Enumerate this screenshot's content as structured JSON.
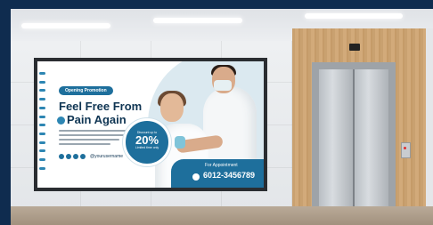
{
  "ad": {
    "promo_label": "Opening Promotion",
    "headline_line1": "Feel Free From",
    "headline_line2": "Pain Again",
    "social_handle": "@yourusername",
    "badge_top": "Discount up to",
    "badge_value": "20%",
    "badge_bottom": "Limited time only",
    "appointment_label": "For Appointment",
    "phone": "6012-3456789"
  },
  "colors": {
    "frame": "#0f2c4f",
    "accent": "#1e6f9c",
    "headline": "#0f3553",
    "wood": "#c9a170"
  },
  "icons": [
    "facebook-icon",
    "twitter-icon",
    "instagram-icon",
    "youtube-icon",
    "phone-icon"
  ]
}
